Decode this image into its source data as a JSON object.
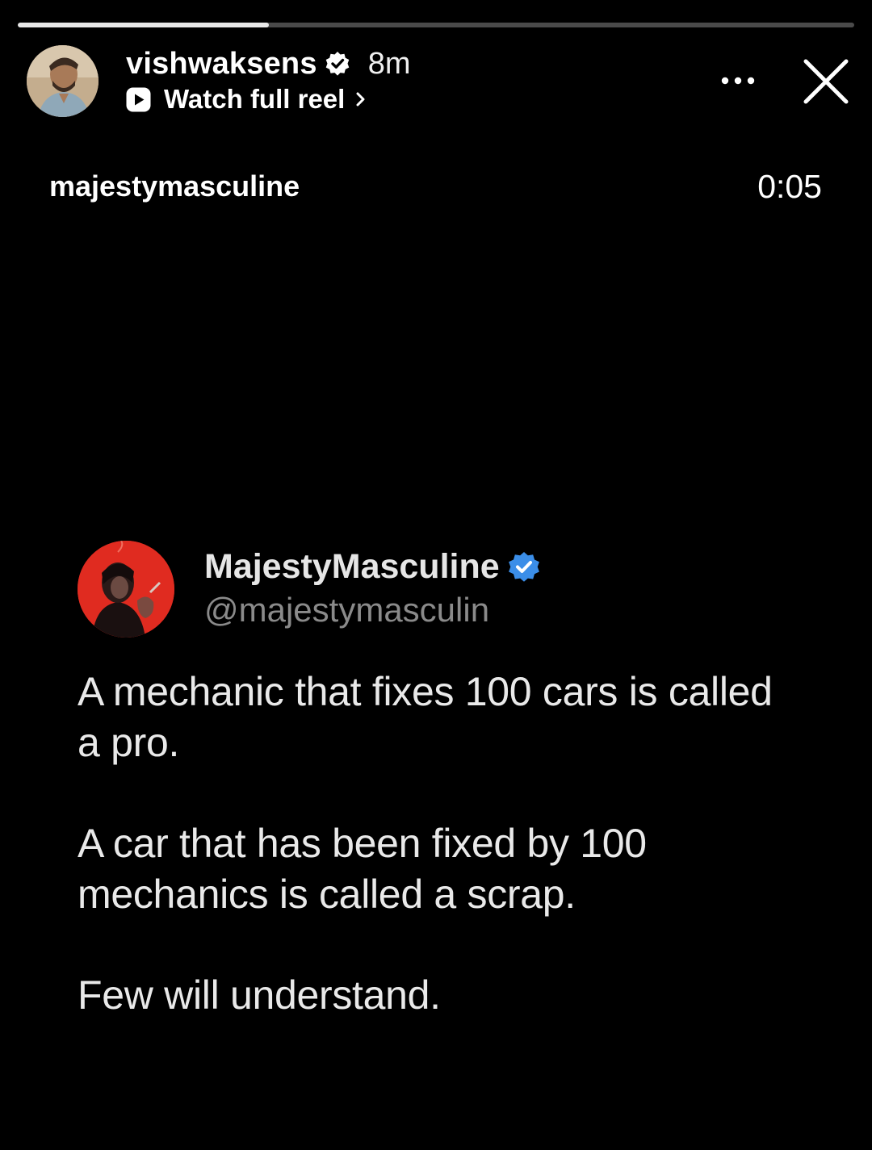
{
  "story": {
    "progress": 0.3
  },
  "header": {
    "username": "vishwaksens",
    "verified": true,
    "time_ago": "8m",
    "reel_link_label": "Watch full reel",
    "more_icon": "more-horizontal-icon",
    "close_icon": "close-icon"
  },
  "media": {
    "source_account": "majestymasculine",
    "timestamp": "0:05"
  },
  "tweet": {
    "display_name": "MajestyMasculine",
    "verified": true,
    "handle": "@majestymasculin",
    "paragraphs": [
      "A mechanic that fixes 100 cars is called a pro.",
      "A car that has been fixed by 100 mechanics is called a scrap.",
      "Few will understand."
    ]
  },
  "colors": {
    "background": "#000000",
    "progress_track": "#4a4a4a",
    "progress_fill": "#e8e8e8",
    "verified_blue": "#3b8ee8",
    "tweet_avatar_bg": "#e02b20",
    "handle_gray": "#8a8a8a"
  }
}
